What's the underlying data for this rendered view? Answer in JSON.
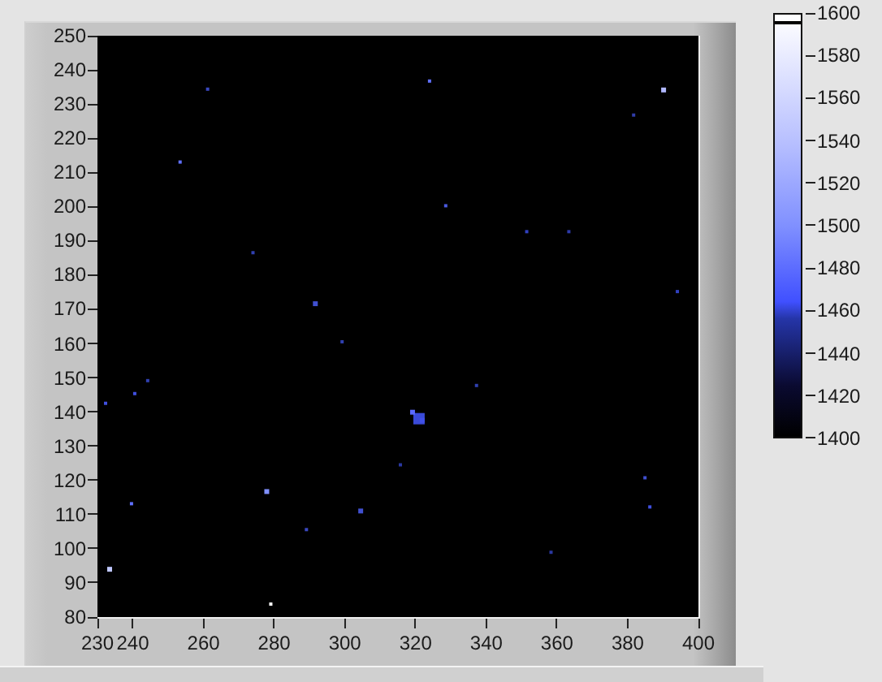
{
  "graph": {
    "y_axis": {
      "ticks": [
        "250",
        "240",
        "230",
        "220",
        "210",
        "200",
        "190",
        "180",
        "170",
        "160",
        "150",
        "140",
        "130",
        "120",
        "110",
        "100",
        "90",
        "80"
      ]
    },
    "x_axis": {
      "ticks": [
        "230",
        "240",
        "260",
        "280",
        "300",
        "320",
        "340",
        "360",
        "380",
        "400"
      ]
    }
  },
  "color_scale": {
    "ticks": [
      "1600",
      "1580",
      "1560",
      "1540",
      "1520",
      "1500",
      "1480",
      "1460",
      "1440",
      "1420",
      "1400"
    ]
  }
}
